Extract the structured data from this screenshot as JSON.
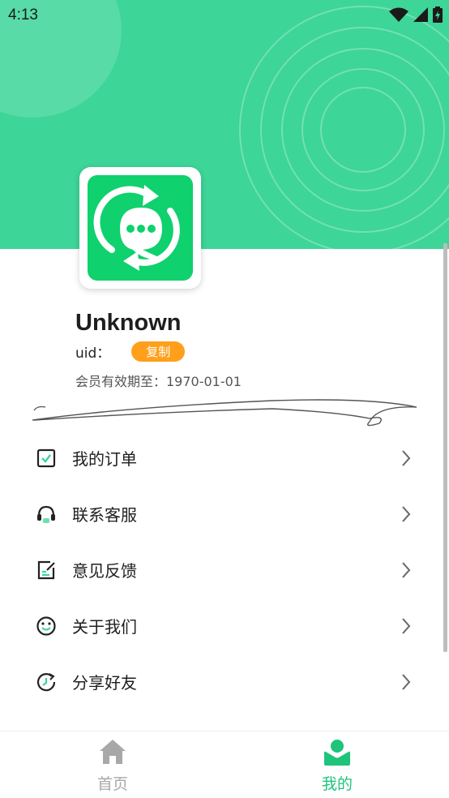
{
  "status_bar": {
    "time": "4:13"
  },
  "profile": {
    "name": "Unknown",
    "uid_label": "uid：",
    "copy_label": "复制",
    "expiry_label": "会员有效期至：1970-01-01"
  },
  "menu": {
    "items": [
      {
        "label": "我的订单",
        "icon": "order-checkbox-icon"
      },
      {
        "label": "联系客服",
        "icon": "headset-icon"
      },
      {
        "label": "意见反馈",
        "icon": "feedback-edit-icon"
      },
      {
        "label": "关于我们",
        "icon": "smiley-icon"
      },
      {
        "label": "分享好友",
        "icon": "share-refresh-icon"
      }
    ]
  },
  "bottom_nav": {
    "tabs": [
      {
        "label": "首页",
        "icon": "home-icon",
        "active": false
      },
      {
        "label": "我的",
        "icon": "profile-icon",
        "active": true
      }
    ]
  },
  "colors": {
    "accent": "#3dd598",
    "active_tab": "#1ec47a",
    "inactive_tab": "#a8a8a8",
    "copy_badge": "#ff9f1a"
  }
}
